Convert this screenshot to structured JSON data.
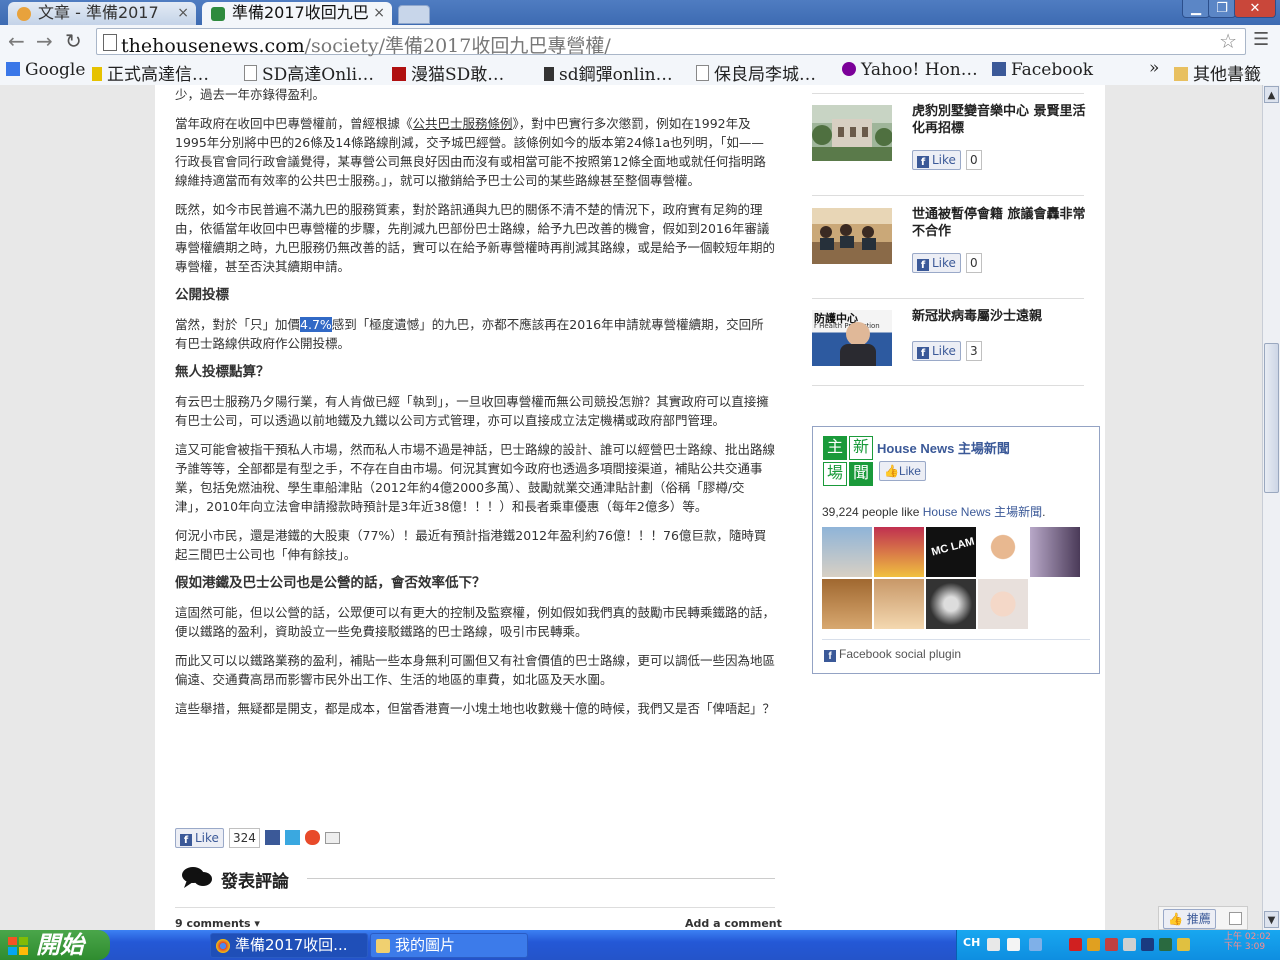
{
  "browser": {
    "tabs": [
      {
        "label": "文章 - 準備2017"
      },
      {
        "label": "準備2017收回九巴"
      }
    ],
    "tab_close": "×",
    "window_buttons": {
      "minimize": "▁",
      "maximize": "❐",
      "close": "✕"
    },
    "nav": {
      "back": "←",
      "forward": "→",
      "reload": "↻"
    },
    "url_host": "thehousenews.com",
    "url_path": "/society/準備2017收回九巴專營權/",
    "star": "☆",
    "menu": "☰"
  },
  "bookmarks": {
    "items": [
      {
        "label": "Google",
        "color": "#3a77e8"
      },
      {
        "label": "正式高達信…",
        "color": "#e6c200"
      },
      {
        "label": "SD高達Onli…",
        "color": "#ffffff"
      },
      {
        "label": "漫猫SD敢…",
        "color": "#b01010"
      },
      {
        "label": "sd鋼彈onlin…",
        "color": "#333333"
      },
      {
        "label": "保良局李城…",
        "color": "#ffffff"
      },
      {
        "label": "Yahoo! Hon…",
        "color": "#7b0099"
      },
      {
        "label": "Facebook",
        "color": "#3b5998"
      }
    ],
    "overflow": "»",
    "other": "其他書籤"
  },
  "article": {
    "p0": "少，過去一年亦錄得盈利。",
    "p1_before": "當年政府在收回中巴專營權前，曾經根據《",
    "p1_link": "公共巴士服務條例",
    "p1_after": "》，對中巴實行多次懲罰，例如在1992年及1995年分別將中巴的26條及14條路線削減，交予城巴經營。該條例如今的版本第24條1a也列明，「如——行政長官會同行政會議覺得，某專營公司無良好因由而沒有或相當可能不按照第12條全面地或就任何指明路線維持適當而有效率的公共巴士服務。」，就可以撤銷給予巴士公司的某些路線甚至整個專營權。",
    "p2": "既然，如今市民普遍不滿九巴的服務質素，對於路訊通與九巴的關係不清不楚的情況下，政府實有足夠的理由，依循當年收回中巴專營權的步驟，先削減九巴部份巴士路線，給予九巴改善的機會，假如到2016年審議專營權續期之時，九巴服務仍無改善的話，實可以在給予新專營權時再削減其路線，或是給予一個較短年期的專營權，甚至否決其續期申請。",
    "h1": "公開投標",
    "p3_before": "當然，對於「只」加價",
    "p3_hl": "4.7%",
    "p3_after": "感到「極度遺憾」的九巴，亦都不應該再在2016年申請就專營權續期，交回所有巴士路線供政府作公開投標。",
    "h2": "無人投標點算？",
    "p4": "有云巴士服務乃夕陽行業，有人肯做已經「執到」，一旦收回專營權而無公司競投怎辦？其實政府可以直接擁有巴士公司，可以透過以前地鐵及九鐵以公司方式管理，亦可以直接成立法定機構或政府部門管理。",
    "p5": "這又可能會被指干預私人市場，然而私人市場不過是神話，巴士路線的設計、誰可以經營巴士路線、批出路線予誰等等，全部都是有型之手，不存在自由市場。何況其實如今政府也透過多項間接渠道，補貼公共交通事業，包括免燃油稅、學生車船津貼（2012年約4億2000多萬）、鼓勵就業交通津貼計劃（俗稱「膠樽/交津」，2010年向立法會申請撥款時預計是3年近38億！！！）和長者乘車優惠（每年2億多）等。",
    "p6": "何況小市民，還是港鐵的大股東（77%）！最近有預計指港鐵2012年盈利約76億！！！76億巨款，隨時買起三間巴士公司也「伸有餘技」。",
    "h3": "假如港鐵及巴士公司也是公營的話，會否效率低下？",
    "p7": "這固然可能，但以公營的話，公眾便可以有更大的控制及監察權，例如假如我們真的鼓勵市民轉乘鐵路的話，便以鐵路的盈利，資助設立一些免費接駁鐵路的巴士路線，吸引市民轉乘。",
    "p8": "而此又可以以鐵路業務的盈利，補貼一些本身無利可圖但又有社會價值的巴士路線，更可以調低一些因為地區偏遠、交通費高昂而影響市民外出工作、生活的地區的車費，如北區及天水圍。",
    "p9": "這些舉措，無疑都是開支，都是成本，但當香港賣一小塊土地也收數幾十億的時候，我們又是否「俾唔起」？"
  },
  "share": {
    "like": "Like",
    "count": "324"
  },
  "comments": {
    "title": "發表評論",
    "count": "9 comments ▾",
    "add": "Add a comment"
  },
  "sidebar": {
    "news": [
      {
        "title": "虎豹別墅變音樂中心 景賢里活化再招標",
        "likes": "0"
      },
      {
        "title": "世通被暫停會籍 旅議會轟非常不合作",
        "likes": "0"
      },
      {
        "title": "新冠狀病毒屬沙士遠親",
        "likes": "3",
        "thumb_text": "防護中心",
        "thumb_sub": "r Health Protection"
      }
    ],
    "fb": {
      "page_name": "House News 主場新聞",
      "logo_chars": [
        "主",
        "新",
        "場",
        "聞"
      ],
      "like": "Like",
      "count_text": "39,224 people like ",
      "count_link": "House News 主場新聞",
      "count_end": ".",
      "face_text": "MC LAM",
      "plugin": "Facebook social plugin"
    }
  },
  "scroll": {
    "up": "▲",
    "down": "▼"
  },
  "float_share": {
    "label": "推薦"
  },
  "taskbar": {
    "start": "開始",
    "tasks": [
      {
        "label": "準備2017收回..."
      },
      {
        "label": "我的圖片"
      }
    ],
    "lang": "CH",
    "clock": [
      "上午 02:02",
      "下午 3:09"
    ]
  }
}
